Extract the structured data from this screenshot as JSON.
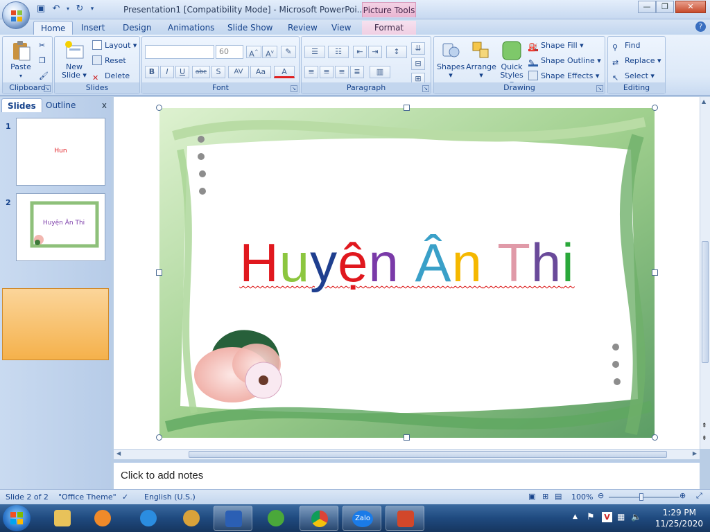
{
  "window": {
    "title": "Presentation1 [Compatibility Mode] - Microsoft PowerPoi...",
    "context_tab_group": "Picture Tools",
    "controls": {
      "minimize": "—",
      "maximize": "❐",
      "close": "✕"
    }
  },
  "tabs": [
    "Home",
    "Insert",
    "Design",
    "Animations",
    "Slide Show",
    "Review",
    "View",
    "Format"
  ],
  "ribbon": {
    "clipboard": {
      "label": "Clipboard",
      "paste": "Paste"
    },
    "slides": {
      "label": "Slides",
      "new_slide_line1": "New",
      "new_slide_line2": "Slide",
      "layout": "Layout",
      "reset": "Reset",
      "delete": "Delete"
    },
    "font": {
      "label": "Font",
      "font_name": "",
      "font_size": "60",
      "bold": "B",
      "italic": "I",
      "underline": "U",
      "strike": "abc",
      "shadow": "S",
      "spacing": "AV",
      "case": "Aa",
      "color": "A"
    },
    "paragraph": {
      "label": "Paragraph"
    },
    "drawing": {
      "label": "Drawing",
      "shapes": "Shapes",
      "arrange": "Arrange",
      "quick_styles_line1": "Quick",
      "quick_styles_line2": "Styles",
      "shape_fill": "Shape Fill",
      "shape_outline": "Shape Outline",
      "shape_effects": "Shape Effects"
    },
    "editing": {
      "label": "Editing",
      "find": "Find",
      "replace": "Replace",
      "select": "Select"
    }
  },
  "left_panel": {
    "tabs": [
      "Slides",
      "Outline"
    ],
    "close": "x",
    "thumbnails": [
      {
        "number": "1",
        "text": "Hun"
      },
      {
        "number": "2",
        "text": "Huyện  Ân  Thi"
      }
    ]
  },
  "slide": {
    "title_parts": [
      {
        "text": "H",
        "color": "#e0181e"
      },
      {
        "text": "u",
        "color": "#8cc63f"
      },
      {
        "text": "y",
        "color": "#1f3f8f"
      },
      {
        "text": "ệ",
        "color": "#e0181e"
      },
      {
        "text": "n",
        "color": "#7a3aa8"
      },
      {
        "text": " ",
        "color": "#000000"
      },
      {
        "text": "Â",
        "color": "#3aa0c8"
      },
      {
        "text": "n",
        "color": "#f5b800"
      },
      {
        "text": " ",
        "color": "#000000"
      },
      {
        "text": "T",
        "color": "#e09aa8"
      },
      {
        "text": "h",
        "color": "#6a4a9a"
      },
      {
        "text": "i",
        "color": "#2aa83a"
      }
    ]
  },
  "notes": {
    "placeholder": "Click to add notes"
  },
  "status": {
    "slide": "Slide 2 of 2",
    "theme": "\"Office Theme\"",
    "language": "English (U.S.)",
    "zoom": "100%"
  },
  "taskbar": {
    "time": "1:29 PM",
    "date": "11/25/2020",
    "zalo_label": "Zalo"
  }
}
